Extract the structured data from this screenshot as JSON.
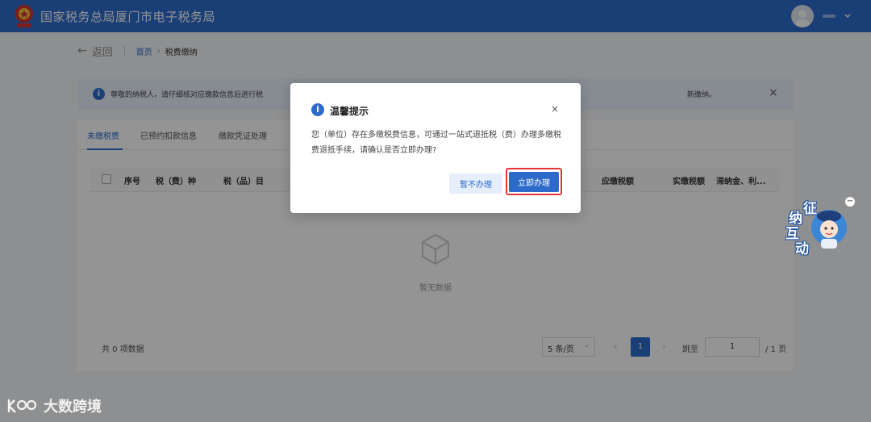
{
  "header": {
    "title": "国家税务总局厦门市电子税务局"
  },
  "breadcrumb": {
    "back": "返回",
    "home": "首页",
    "sep": "›",
    "current": "税费缴纳"
  },
  "notice": {
    "text_left": "尊敬的纳税人，请仔细核对应缴款信息后进行税",
    "text_right": "新缴纳。",
    "close": "×"
  },
  "tabs": [
    "未缴税费",
    "已预约扣款信息",
    "缴款凭证处理"
  ],
  "table": {
    "columns": [
      "序号",
      "税（费）种",
      "税（品）目",
      "应缴税额",
      "实缴税额",
      "滞纳金、利..."
    ]
  },
  "empty": {
    "text": "暂无数据"
  },
  "pagination": {
    "total": "共 0 项数据",
    "page_size": "5 条/页",
    "page": "1",
    "jump_label": "跳至",
    "jump_value": "1",
    "page_total": "/ 1 页"
  },
  "widget": {
    "chars": [
      "征",
      "纳",
      "互",
      "动"
    ],
    "minus": "−"
  },
  "dialog": {
    "title": "温馨提示",
    "close": "×",
    "body": "您（单位）存在多缴税费信息，可通过一站式退抵税（费）办理多缴税费退抵手续，请确认是否立即办理?",
    "cancel": "暂不办理",
    "confirm": "立即办理"
  },
  "watermark": {
    "text": "大数跨境"
  },
  "colors": {
    "primary": "#2d6bcb",
    "highlight": "#e53935"
  }
}
